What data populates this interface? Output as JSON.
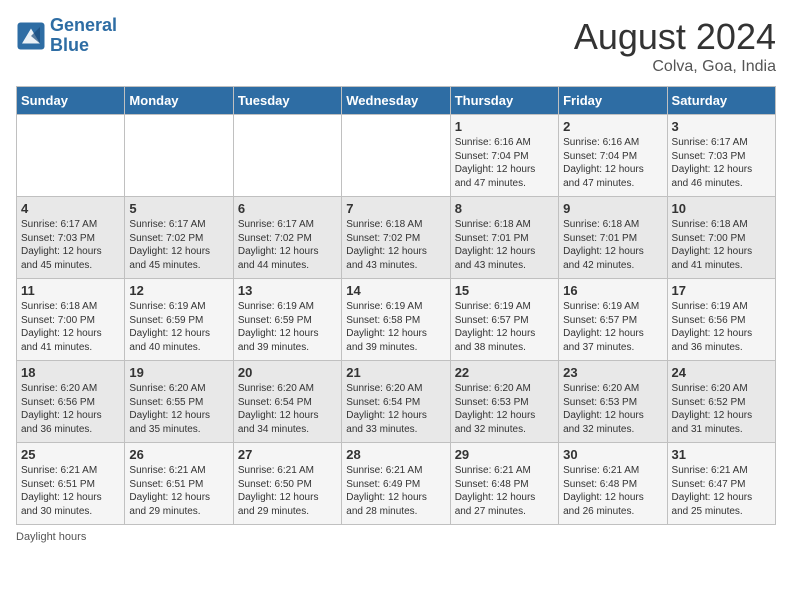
{
  "header": {
    "logo_line1": "General",
    "logo_line2": "Blue",
    "month_title": "August 2024",
    "location": "Colva, Goa, India"
  },
  "days_of_week": [
    "Sunday",
    "Monday",
    "Tuesday",
    "Wednesday",
    "Thursday",
    "Friday",
    "Saturday"
  ],
  "weeks": [
    [
      {
        "day": "",
        "text": ""
      },
      {
        "day": "",
        "text": ""
      },
      {
        "day": "",
        "text": ""
      },
      {
        "day": "",
        "text": ""
      },
      {
        "day": "1",
        "text": "Sunrise: 6:16 AM\nSunset: 7:04 PM\nDaylight: 12 hours and 47 minutes."
      },
      {
        "day": "2",
        "text": "Sunrise: 6:16 AM\nSunset: 7:04 PM\nDaylight: 12 hours and 47 minutes."
      },
      {
        "day": "3",
        "text": "Sunrise: 6:17 AM\nSunset: 7:03 PM\nDaylight: 12 hours and 46 minutes."
      }
    ],
    [
      {
        "day": "4",
        "text": "Sunrise: 6:17 AM\nSunset: 7:03 PM\nDaylight: 12 hours and 45 minutes."
      },
      {
        "day": "5",
        "text": "Sunrise: 6:17 AM\nSunset: 7:02 PM\nDaylight: 12 hours and 45 minutes."
      },
      {
        "day": "6",
        "text": "Sunrise: 6:17 AM\nSunset: 7:02 PM\nDaylight: 12 hours and 44 minutes."
      },
      {
        "day": "7",
        "text": "Sunrise: 6:18 AM\nSunset: 7:02 PM\nDaylight: 12 hours and 43 minutes."
      },
      {
        "day": "8",
        "text": "Sunrise: 6:18 AM\nSunset: 7:01 PM\nDaylight: 12 hours and 43 minutes."
      },
      {
        "day": "9",
        "text": "Sunrise: 6:18 AM\nSunset: 7:01 PM\nDaylight: 12 hours and 42 minutes."
      },
      {
        "day": "10",
        "text": "Sunrise: 6:18 AM\nSunset: 7:00 PM\nDaylight: 12 hours and 41 minutes."
      }
    ],
    [
      {
        "day": "11",
        "text": "Sunrise: 6:18 AM\nSunset: 7:00 PM\nDaylight: 12 hours and 41 minutes."
      },
      {
        "day": "12",
        "text": "Sunrise: 6:19 AM\nSunset: 6:59 PM\nDaylight: 12 hours and 40 minutes."
      },
      {
        "day": "13",
        "text": "Sunrise: 6:19 AM\nSunset: 6:59 PM\nDaylight: 12 hours and 39 minutes."
      },
      {
        "day": "14",
        "text": "Sunrise: 6:19 AM\nSunset: 6:58 PM\nDaylight: 12 hours and 39 minutes."
      },
      {
        "day": "15",
        "text": "Sunrise: 6:19 AM\nSunset: 6:57 PM\nDaylight: 12 hours and 38 minutes."
      },
      {
        "day": "16",
        "text": "Sunrise: 6:19 AM\nSunset: 6:57 PM\nDaylight: 12 hours and 37 minutes."
      },
      {
        "day": "17",
        "text": "Sunrise: 6:19 AM\nSunset: 6:56 PM\nDaylight: 12 hours and 36 minutes."
      }
    ],
    [
      {
        "day": "18",
        "text": "Sunrise: 6:20 AM\nSunset: 6:56 PM\nDaylight: 12 hours and 36 minutes."
      },
      {
        "day": "19",
        "text": "Sunrise: 6:20 AM\nSunset: 6:55 PM\nDaylight: 12 hours and 35 minutes."
      },
      {
        "day": "20",
        "text": "Sunrise: 6:20 AM\nSunset: 6:54 PM\nDaylight: 12 hours and 34 minutes."
      },
      {
        "day": "21",
        "text": "Sunrise: 6:20 AM\nSunset: 6:54 PM\nDaylight: 12 hours and 33 minutes."
      },
      {
        "day": "22",
        "text": "Sunrise: 6:20 AM\nSunset: 6:53 PM\nDaylight: 12 hours and 32 minutes."
      },
      {
        "day": "23",
        "text": "Sunrise: 6:20 AM\nSunset: 6:53 PM\nDaylight: 12 hours and 32 minutes."
      },
      {
        "day": "24",
        "text": "Sunrise: 6:20 AM\nSunset: 6:52 PM\nDaylight: 12 hours and 31 minutes."
      }
    ],
    [
      {
        "day": "25",
        "text": "Sunrise: 6:21 AM\nSunset: 6:51 PM\nDaylight: 12 hours and 30 minutes."
      },
      {
        "day": "26",
        "text": "Sunrise: 6:21 AM\nSunset: 6:51 PM\nDaylight: 12 hours and 29 minutes."
      },
      {
        "day": "27",
        "text": "Sunrise: 6:21 AM\nSunset: 6:50 PM\nDaylight: 12 hours and 29 minutes."
      },
      {
        "day": "28",
        "text": "Sunrise: 6:21 AM\nSunset: 6:49 PM\nDaylight: 12 hours and 28 minutes."
      },
      {
        "day": "29",
        "text": "Sunrise: 6:21 AM\nSunset: 6:48 PM\nDaylight: 12 hours and 27 minutes."
      },
      {
        "day": "30",
        "text": "Sunrise: 6:21 AM\nSunset: 6:48 PM\nDaylight: 12 hours and 26 minutes."
      },
      {
        "day": "31",
        "text": "Sunrise: 6:21 AM\nSunset: 6:47 PM\nDaylight: 12 hours and 25 minutes."
      }
    ]
  ],
  "footer_text": "Daylight hours"
}
